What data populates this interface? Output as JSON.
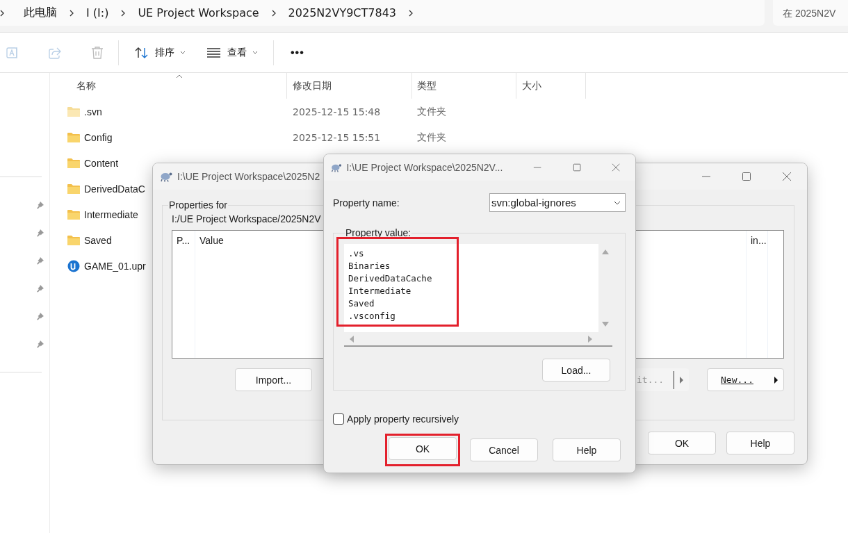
{
  "explorer": {
    "breadcrumb": [
      "此电脑",
      "I (I:)",
      "UE Project Workspace",
      "2025N2VY9CT7843"
    ],
    "search": {
      "placeholder": "在 2025N2V"
    },
    "toolbar": [
      {
        "kind": "rename",
        "disabled": true
      },
      {
        "kind": "share",
        "disabled": true
      },
      {
        "kind": "delete",
        "disabled": true
      },
      {
        "kind": "sort",
        "label": "排序",
        "disabled": false
      },
      {
        "kind": "view",
        "label": "查看",
        "disabled": false
      },
      {
        "kind": "more",
        "label": "•••",
        "disabled": false
      }
    ],
    "columns": [
      "名称",
      "修改日期",
      "类型",
      "大小"
    ],
    "rows": [
      {
        "kind": "folder",
        "name": ".svn",
        "date": "2025-12-15 15:48",
        "type": "文件夹"
      },
      {
        "kind": "folder",
        "name": "Config",
        "date": "2025-12-15 15:51",
        "type": "文件夹"
      },
      {
        "kind": "folder",
        "name": "Content"
      },
      {
        "kind": "folder",
        "name": "DerivedDataC"
      },
      {
        "kind": "folder",
        "name": "Intermediate"
      },
      {
        "kind": "folder",
        "name": "Saved"
      },
      {
        "kind": "project",
        "name": "GAME_01.upr"
      }
    ]
  },
  "properties_dialog": {
    "title": "I:\\UE Project Workspace\\2025N2",
    "group_label": "Properties for",
    "path": "I:/UE Project Workspace/2025N2V",
    "table_columns": [
      "P...",
      "Value",
      "in..."
    ],
    "buttons": [
      {
        "kind": "import",
        "label": "Import..."
      },
      {
        "kind": "edit",
        "label": "it..."
      },
      {
        "kind": "new",
        "label": "New..."
      }
    ],
    "footer_buttons": [
      "OK",
      "Help"
    ]
  },
  "edit_dialog": {
    "title": "I:\\UE Project Workspace\\2025N2V...",
    "property_name_label": "Property name:",
    "property_name": "svn:global-ignores",
    "property_value_label": "Property value:",
    "property_value": [
      ".vs",
      "Binaries",
      "DerivedDataCache",
      "Intermediate",
      "Saved",
      ".vsconfig"
    ],
    "value_highlighted": true,
    "load_button": "Load...",
    "recursive": {
      "label": "Apply property recursively",
      "checked": false
    },
    "buttons": [
      {
        "label": "OK",
        "highlighted": true
      },
      {
        "label": "Cancel",
        "highlighted": false
      },
      {
        "label": "Help",
        "highlighted": false
      }
    ]
  }
}
